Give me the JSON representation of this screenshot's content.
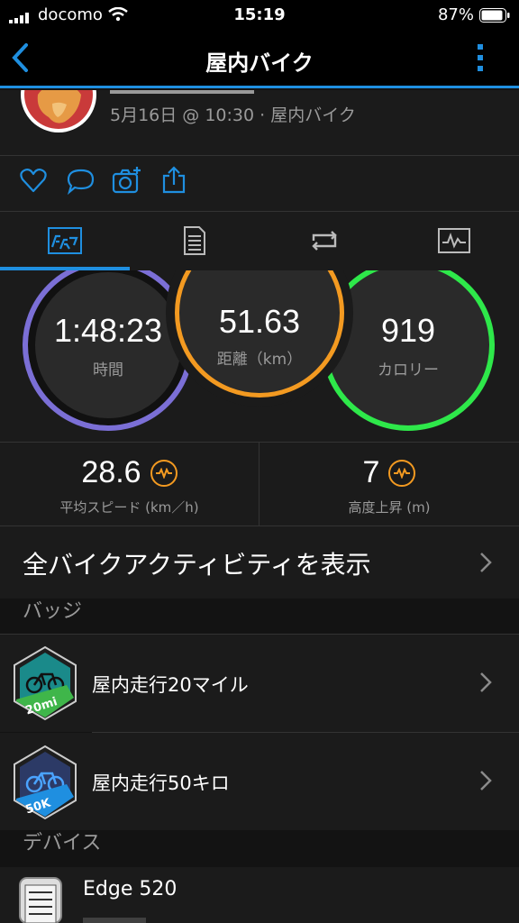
{
  "status_bar": {
    "carrier": "docomo",
    "time": "15:19",
    "battery": "87%"
  },
  "nav": {
    "title": "屋内バイク"
  },
  "header": {
    "subtitle": "5月16日 @ 10:30 · 屋内バイク"
  },
  "stats": {
    "time": {
      "value": "1:48:23",
      "label": "時間"
    },
    "distance": {
      "value": "51.63",
      "label": "距離（km）"
    },
    "calories": {
      "value": "919",
      "label": "カロリー"
    }
  },
  "metrics": {
    "avg_speed": {
      "value": "28.6",
      "label": "平均スピード (km／h)"
    },
    "elevation": {
      "value": "7",
      "label": "高度上昇 (m)"
    }
  },
  "all_activities": {
    "label": "全バイクアクティビティを表示"
  },
  "badges": {
    "section_title": "バッジ",
    "items": [
      {
        "label": "屋内走行20マイル",
        "badge_text": "20mi",
        "badge_color": "#3fb64a"
      },
      {
        "label": "屋内走行50キロ",
        "badge_text": "50K",
        "badge_color": "#1f8fe0"
      }
    ]
  },
  "devices": {
    "section_title": "デバイス",
    "items": [
      {
        "label": "Edge 520"
      }
    ]
  },
  "colors": {
    "accent": "#1f8fe0",
    "time_ring": "#7b6fd6",
    "distance_ring": "#f39a21",
    "calorie_ring": "#2ee84a"
  }
}
